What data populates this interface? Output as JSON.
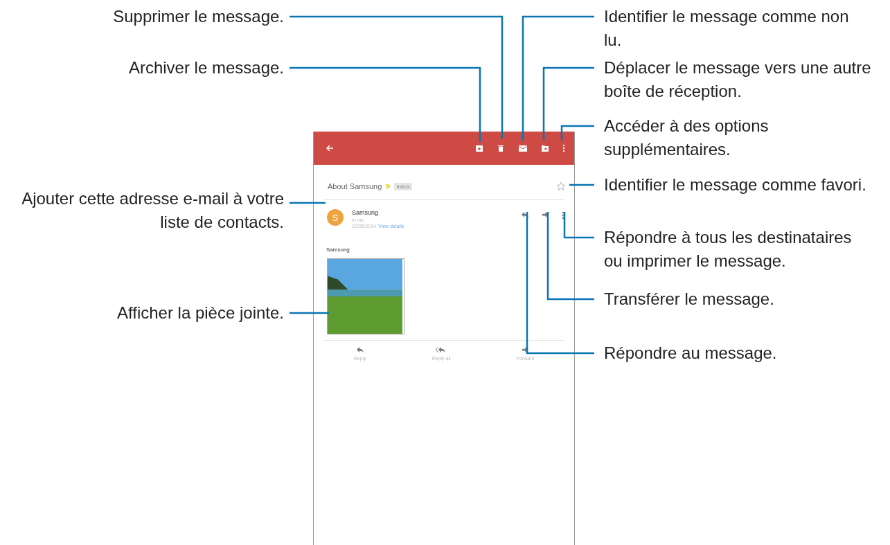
{
  "left_callouts": [
    {
      "text": "Supprimer le message."
    },
    {
      "text": "Archiver le message."
    },
    {
      "text": "Ajouter cette adresse e-mail à votre liste de contacts."
    },
    {
      "text": "Afficher la pièce jointe."
    }
  ],
  "right_callouts": [
    {
      "text": "Identifier le message comme non lu."
    },
    {
      "text": "Déplacer le message vers une autre boîte de réception."
    },
    {
      "text": "Accéder à des options supplémentaires."
    },
    {
      "text": "Identifier le message comme favori."
    },
    {
      "text": "Répondre à tous les destinataires ou imprimer le message."
    },
    {
      "text": "Transférer le message."
    },
    {
      "text": "Répondre au message."
    }
  ],
  "email": {
    "subject": "About Samsung",
    "label": "Inbox",
    "starred": false,
    "sender": {
      "initial": "S",
      "name": "Samsung",
      "to": "to me",
      "date": "12/05/2014",
      "details_link": "View details"
    },
    "body": "Samsung",
    "actions": [
      {
        "kind": "reply",
        "label": "Reply"
      },
      {
        "kind": "reply_all",
        "label": "Reply all"
      },
      {
        "kind": "forward",
        "label": "Forward"
      }
    ]
  }
}
